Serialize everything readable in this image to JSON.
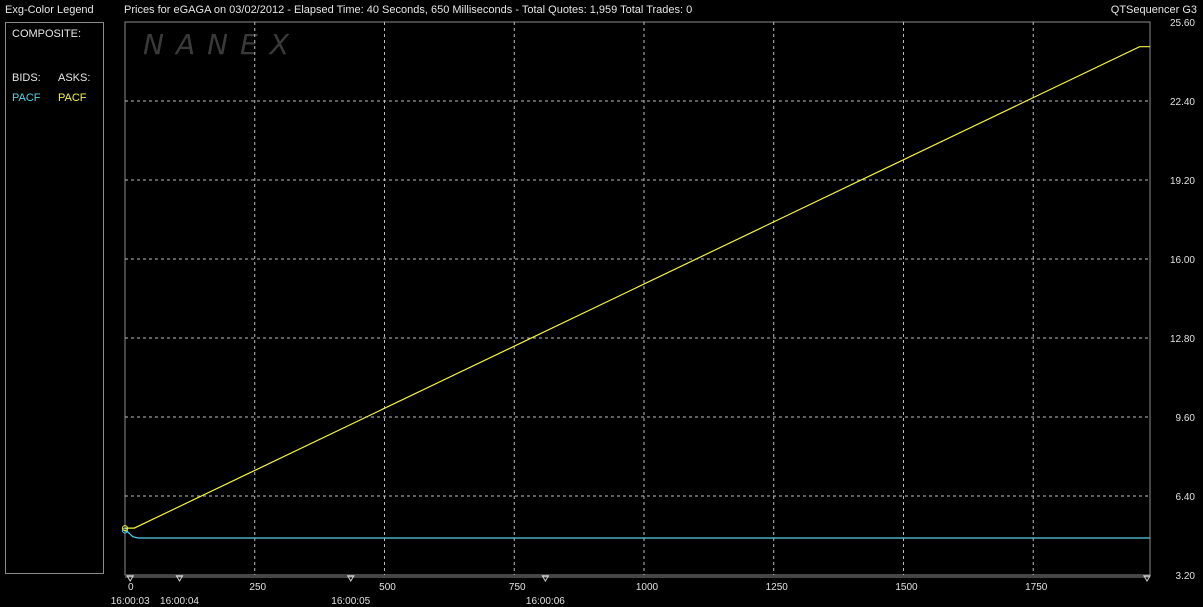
{
  "header": {
    "legend_title": "Exg-Color Legend",
    "chart_title": "Prices for  eGAGA  on  03/02/2012  -  Elapsed Time: 40 Seconds, 650 Milliseconds  -  Total Quotes: 1,959  Total Trades: 0",
    "app_title": "QTSequencer G3"
  },
  "legend": {
    "composite_label": "COMPOSITE:",
    "bids_label": "BIDS:",
    "asks_label": "ASKS:",
    "bids_exchange": "PACF",
    "asks_exchange": "PACF"
  },
  "watermark": "NANEX",
  "colors": {
    "background": "#000000",
    "grid": "#bdbdbd",
    "frame": "#8a8a8a",
    "bid": "#4fd2e8",
    "ask": "#f2f23a"
  },
  "chart_data": {
    "type": "line",
    "title": "Prices for  eGAGA  on  03/02/2012",
    "xlim": [
      0,
      1975
    ],
    "ylim": [
      3.2,
      25.6
    ],
    "grid": true,
    "x_ticks": [
      "0",
      "250",
      "500",
      "750",
      "1000",
      "1250",
      "1500",
      "1750"
    ],
    "y_ticks": [
      "25.60",
      "22.40",
      "19.20",
      "16.00",
      "12.80",
      "9.60",
      "6.40",
      "3.20"
    ],
    "time_labels": [
      {
        "x": 10,
        "label": "16:00:03"
      },
      {
        "x": 105,
        "label": "16:00:04"
      },
      {
        "x": 435,
        "label": "16:00:05"
      },
      {
        "x": 810,
        "label": "16:00:06"
      }
    ],
    "series": [
      {
        "name": "BIDS PACF",
        "color": "#4fd2e8",
        "points": [
          [
            0,
            5.0
          ],
          [
            5,
            4.95
          ],
          [
            15,
            4.75
          ],
          [
            25,
            4.7
          ],
          [
            1975,
            4.7
          ]
        ]
      },
      {
        "name": "ASKS PACF",
        "color": "#f2f23a",
        "points": [
          [
            0,
            5.1
          ],
          [
            18,
            5.1
          ],
          [
            1955,
            24.6
          ],
          [
            1975,
            24.6
          ]
        ]
      }
    ]
  }
}
